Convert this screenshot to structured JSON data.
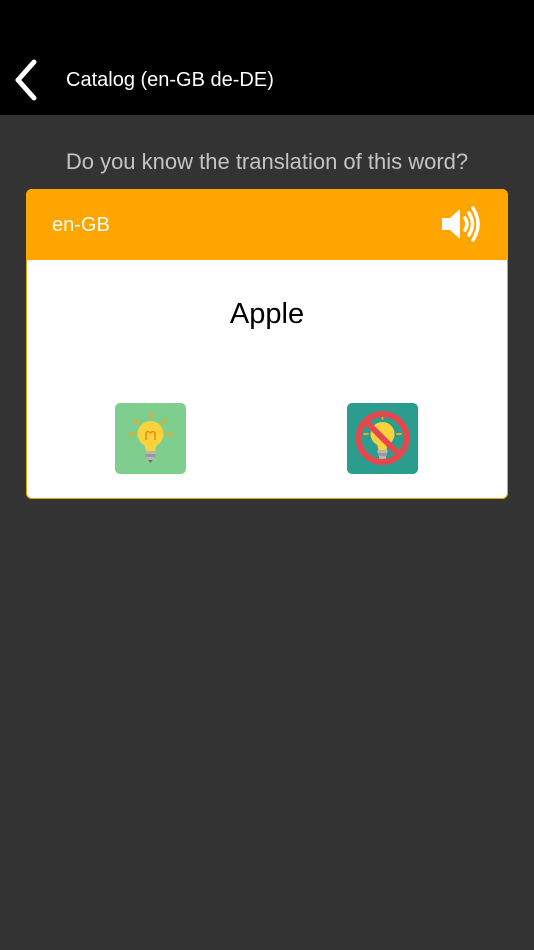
{
  "navbar": {
    "title": "Catalog (en-GB de-DE)",
    "back_icon": "chevron-left-icon"
  },
  "prompt": {
    "question": "Do you know the translation of this word?"
  },
  "card": {
    "language": "en-GB",
    "speaker_icon": "speaker-icon",
    "word": "Apple",
    "know_icon": "lightbulb-icon",
    "dont_know_icon": "lightbulb-crossed-icon"
  },
  "colors": {
    "background": "#333333",
    "navbar": "#000000",
    "accent": "#FFA500",
    "know_button": "#7ECF8E",
    "dont_know_button": "#2A9D8F"
  }
}
